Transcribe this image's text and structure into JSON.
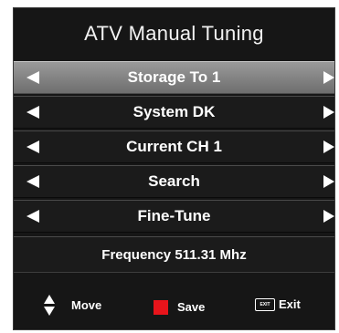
{
  "menu": {
    "title": "ATV Manual Tuning",
    "items": [
      {
        "label": "Storage To 1",
        "selected": true
      },
      {
        "label": "System DK",
        "selected": false
      },
      {
        "label": "Current CH 1",
        "selected": false
      },
      {
        "label": "Search",
        "selected": false
      },
      {
        "label": "Fine-Tune",
        "selected": false
      }
    ],
    "frequency": "Frequency 511.31 Mhz"
  },
  "footer": {
    "move_label": "Move",
    "save_label": "Save",
    "exit_label": "Exit",
    "exit_key_text": "EXIT"
  },
  "colors": {
    "background": "#161616",
    "selected_row": "#8a8a8a",
    "save_key": "#e8141b",
    "text": "#ffffff"
  }
}
